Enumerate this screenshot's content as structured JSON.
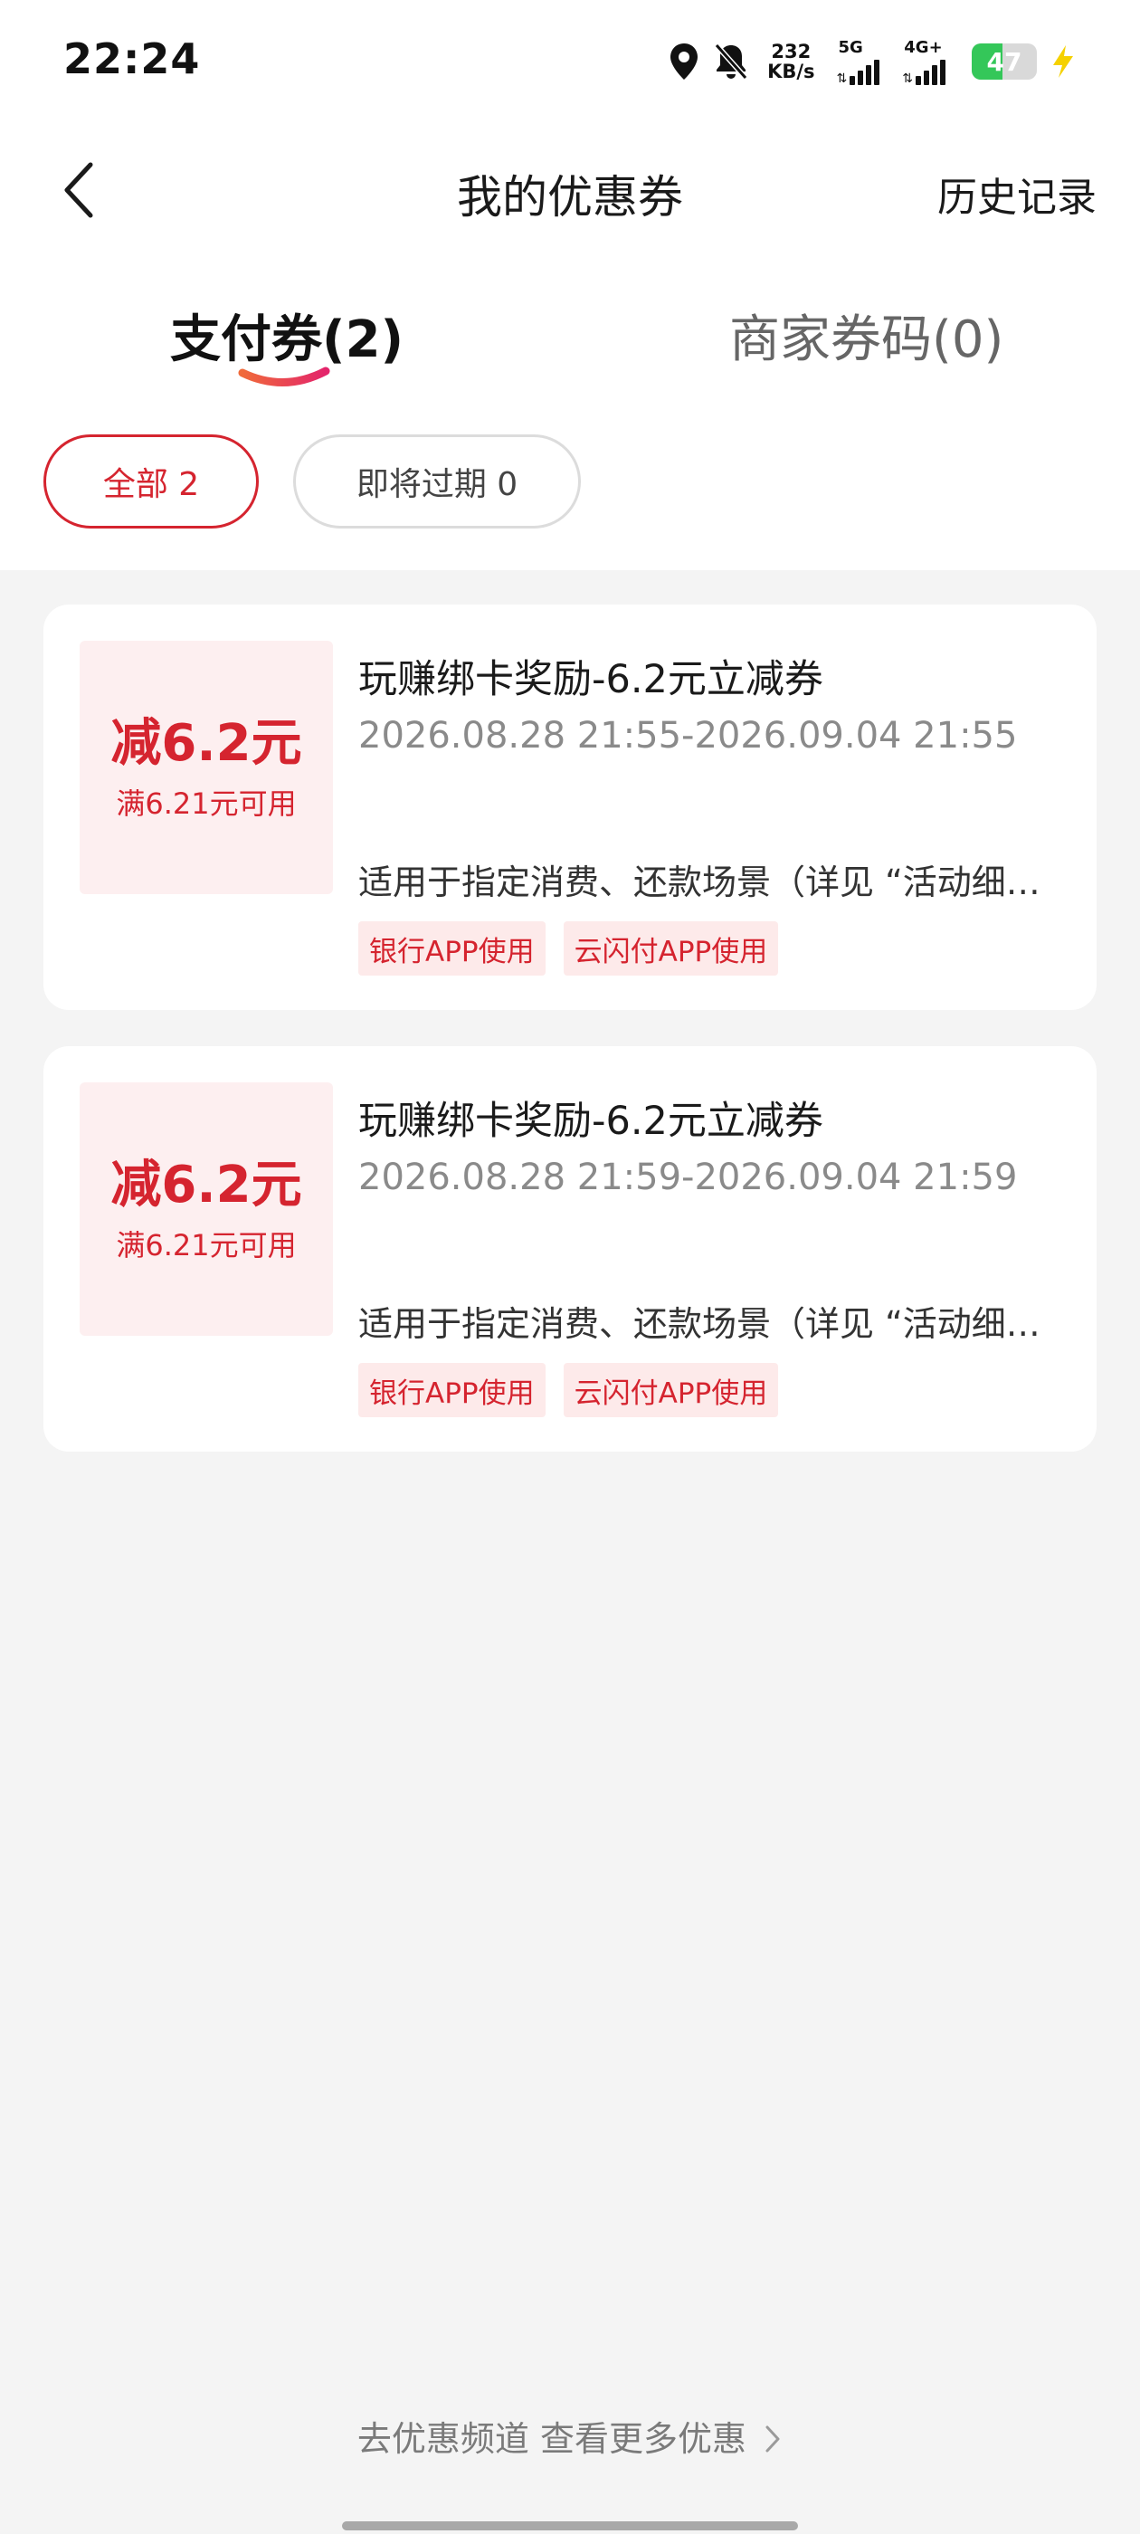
{
  "status_bar": {
    "time": "22:24",
    "net_speed_value": "232",
    "net_speed_unit": "KB/s",
    "signal_1_label": "5G",
    "signal_2_label": "4G+",
    "battery_level": "47",
    "icons": [
      "location-icon",
      "bell-muted-icon",
      "signal-icon",
      "battery-icon",
      "charging-icon"
    ]
  },
  "header": {
    "title": "我的优惠券",
    "history_label": "历史记录",
    "back_icon": "chevron-left-icon"
  },
  "tabs": [
    {
      "label": "支付券(2)",
      "active": true
    },
    {
      "label": "商家券码(0)",
      "active": false
    }
  ],
  "filters": [
    {
      "label": "全部 2",
      "active": true
    },
    {
      "label": "即将过期 0",
      "active": false
    }
  ],
  "coupons": [
    {
      "amount": "减6.2元",
      "condition": "满6.21元可用",
      "title": "玩赚绑卡奖励-6.2元立减券",
      "date_range": "2026.08.28 21:55-2026.09.04 21:55",
      "description": "适用于指定消费、还款场景（详见 “活动细则”）",
      "tags": [
        "银行APP使用",
        "云闪付APP使用"
      ]
    },
    {
      "amount": "减6.2元",
      "condition": "满6.21元可用",
      "title": "玩赚绑卡奖励-6.2元立减券",
      "date_range": "2026.08.28 21:59-2026.09.04 21:59",
      "description": "适用于指定消费、还款场景（详见 “活动细则”）",
      "tags": [
        "银行APP使用",
        "云闪付APP使用"
      ]
    }
  ],
  "footer": {
    "more_link": "去优惠频道 查看更多优惠",
    "more_icon": "chevron-right-icon"
  },
  "colors": {
    "accent": "#d5242f",
    "coupon_bg": "#fdeff0",
    "page_bg": "#f4f4f4",
    "battery_green": "#34c759",
    "charging_yellow": "#f5d100"
  }
}
